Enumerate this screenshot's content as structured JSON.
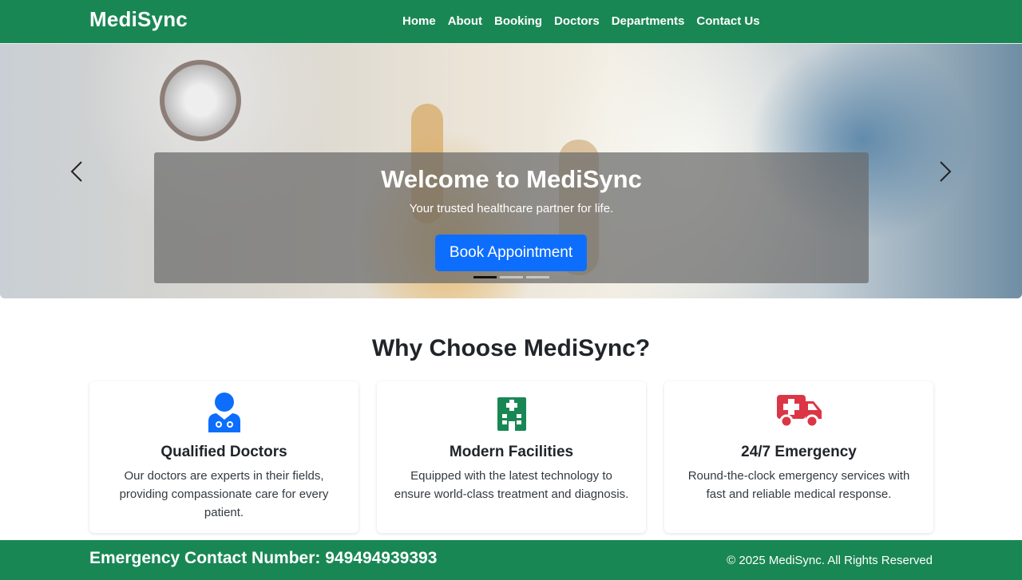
{
  "navbar": {
    "brand": "MediSync",
    "links": [
      "Home",
      "About",
      "Booking",
      "Doctors",
      "Departments",
      "Contact Us"
    ]
  },
  "hero": {
    "title": "Welcome to MediSync",
    "subtitle": "Your trusted healthcare partner for life.",
    "cta_label": "Book Appointment",
    "slide_count": 3,
    "active_slide": 1
  },
  "features": {
    "heading": "Why Choose MediSync?",
    "cards": [
      {
        "icon": "doctor-icon",
        "title": "Qualified Doctors",
        "text": "Our doctors are experts in their fields, providing compassionate care for every patient."
      },
      {
        "icon": "hospital-icon",
        "title": "Modern Facilities",
        "text": "Equipped with the latest technology to ensure world-class treatment and diagnosis."
      },
      {
        "icon": "ambulance-icon",
        "title": "24/7 Emergency",
        "text": "Round-the-clock emergency services with fast and reliable medical response."
      }
    ]
  },
  "footer": {
    "emergency": "Emergency Contact Number: 949494939393",
    "copyright": "© 2025 MediSync. All Rights Reserved"
  },
  "colors": {
    "brand_green": "#198754",
    "primary_blue": "#0d6efd",
    "hospital_green": "#198754",
    "emergency_red": "#dc3545"
  }
}
